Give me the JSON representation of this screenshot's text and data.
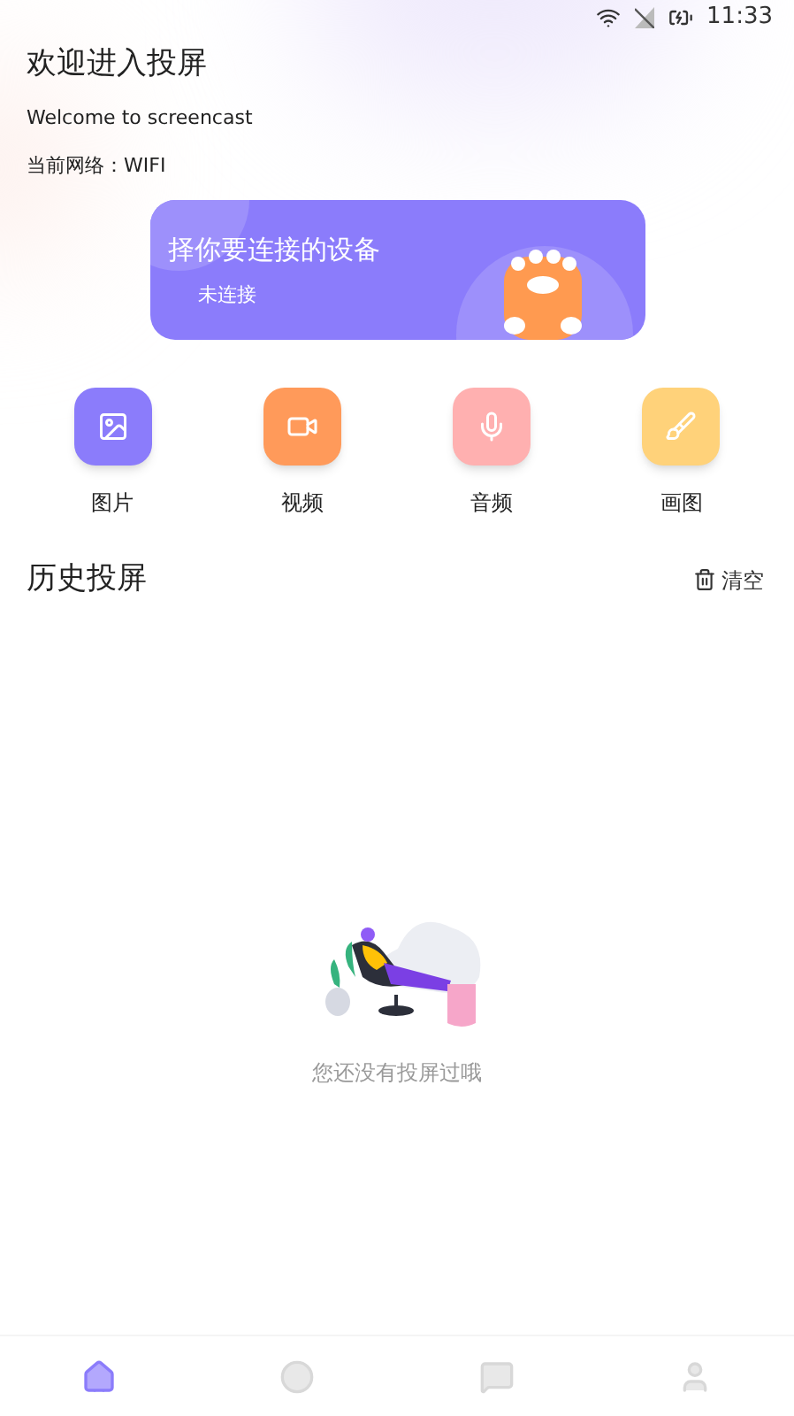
{
  "status_bar": {
    "time": "11:33"
  },
  "header": {
    "title": "欢迎进入投屏",
    "subtitle": "Welcome to screencast",
    "network": "当前网络：WIFI"
  },
  "banner": {
    "title": "择你要连接的设备",
    "status": "未连接"
  },
  "actions": [
    {
      "kind": "image",
      "label": "图片",
      "color": "#8b7cfb"
    },
    {
      "kind": "video",
      "label": "视频",
      "color": "#ff9a5a"
    },
    {
      "kind": "audio",
      "label": "音频",
      "color": "#ffb0b0"
    },
    {
      "kind": "draw",
      "label": "画图",
      "color": "#ffd27a"
    }
  ],
  "history": {
    "title": "历史投屏",
    "clear": "清空",
    "empty": "您还没有投屏过哦"
  },
  "nav": [
    {
      "kind": "home",
      "selected": true
    },
    {
      "kind": "play",
      "selected": false
    },
    {
      "kind": "message",
      "selected": false
    },
    {
      "kind": "profile",
      "selected": false
    }
  ]
}
